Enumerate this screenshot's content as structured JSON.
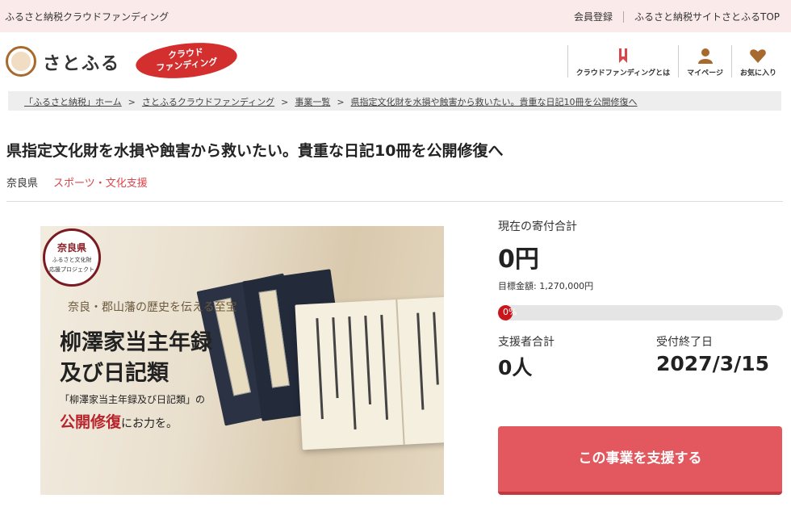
{
  "topbar": {
    "site_name": "ふるさと納税クラウドファンディング",
    "register": "会員登録",
    "top_link": "ふるさと納税サイトさとふるTOP"
  },
  "header": {
    "logo_text": "さとふる",
    "badge_line1": "クラウド",
    "badge_line2": "ファンディング",
    "nav": [
      {
        "label": "クラウドファンディングとは",
        "icon": "bookmark-icon"
      },
      {
        "label": "マイページ",
        "icon": "user-icon"
      },
      {
        "label": "お気に入り",
        "icon": "heart-icon"
      }
    ]
  },
  "breadcrumb": [
    "「ふるさと納税」ホーム",
    "さとふるクラウドファンディング",
    "事業一覧",
    "県指定文化財を水損や蝕害から救いたい。貴重な日記10冊を公開修復へ"
  ],
  "breadcrumb_sep": ">",
  "project": {
    "title": "県指定文化財を水損や蝕害から救いたい。貴重な日記10冊を公開修復へ",
    "region": "奈良県",
    "category": "スポーツ・文化支援"
  },
  "hero": {
    "seal_title": "奈良県",
    "seal_sub1": "ふるさと文化財",
    "seal_sub2": "応援プロジェクト",
    "tagline": "奈良・郡山藩の歴史を伝える至宝",
    "heading1": "柳澤家当主年録",
    "heading2": "及び日記類",
    "quote": "「柳澤家当主年録及び日記類」の",
    "cta_red": "公開修復",
    "cta_rest": "にお力を。"
  },
  "stats": {
    "total_label": "現在の寄付合計",
    "total_value": "0円",
    "target_text": "目標金額: 1,270,000円",
    "progress_text": "0%",
    "progress_percent": 0,
    "supporters_label": "支援者合計",
    "supporters_value": "0人",
    "deadline_label": "受付終了日",
    "deadline_value": "2027/3/15"
  },
  "cta": {
    "label": "この事業を支援する"
  },
  "colors": {
    "accent": "#e2585e",
    "progress_fill": "#c9161d",
    "topbar_bg": "#fbeaea"
  }
}
